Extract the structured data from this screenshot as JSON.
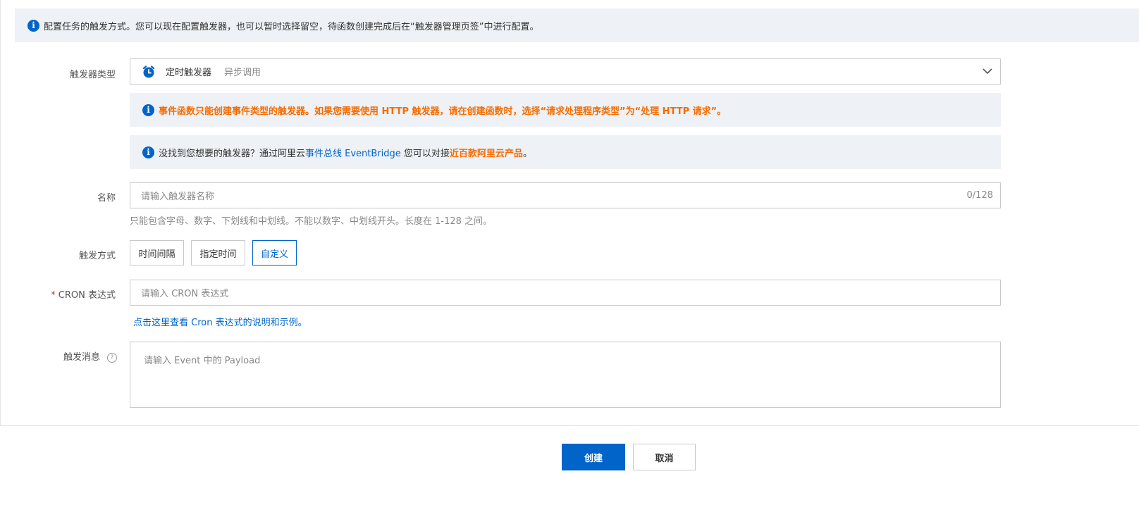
{
  "banner": {
    "icon": "info-icon",
    "text": "配置任务的触发方式。您可以现在配置触发器，也可以暂时选择留空，待函数创建完成后在“触发器管理页签”中进行配置。"
  },
  "trigger_type": {
    "label": "触发器类型",
    "icon": "alarm-clock-icon",
    "value": "定时触发器",
    "sub": "异步调用"
  },
  "notice1": {
    "text": "事件函数只能创建事件类型的触发器。如果您需要使用 HTTP 触发器，请在创建函数时，选择“请求处理程序类型”为“处理 HTTP 请求”。"
  },
  "notice2": {
    "prefix": "没找到您想要的触发器？通过阿里云",
    "link": "事件总线 EventBridge",
    "middle": " 您可以对接",
    "highlight": "近百款阿里云产品",
    "suffix": "。"
  },
  "name": {
    "label": "名称",
    "placeholder": "请输入触发器名称",
    "counter": "0/128",
    "help": "只能包含字母、数字、下划线和中划线。不能以数字、中划线开头。长度在 1-128 之间。"
  },
  "trigger_mode": {
    "label": "触发方式",
    "options": [
      "时间间隔",
      "指定时间",
      "自定义"
    ],
    "selected": "自定义"
  },
  "cron": {
    "required_mark": "*",
    "label": "CRON 表达式",
    "placeholder": "请输入 CRON 表达式",
    "help_link": "点击这里查看 Cron 表达式的说明和示例。"
  },
  "payload": {
    "label": "触发消息",
    "help_icon": "?",
    "placeholder": "请输入 Event 中的 Payload"
  },
  "actions": {
    "create": "创建",
    "cancel": "取消"
  },
  "colors": {
    "primary": "#0064c8",
    "warning": "#f56c00",
    "notice_bg": "#eef1f5"
  }
}
